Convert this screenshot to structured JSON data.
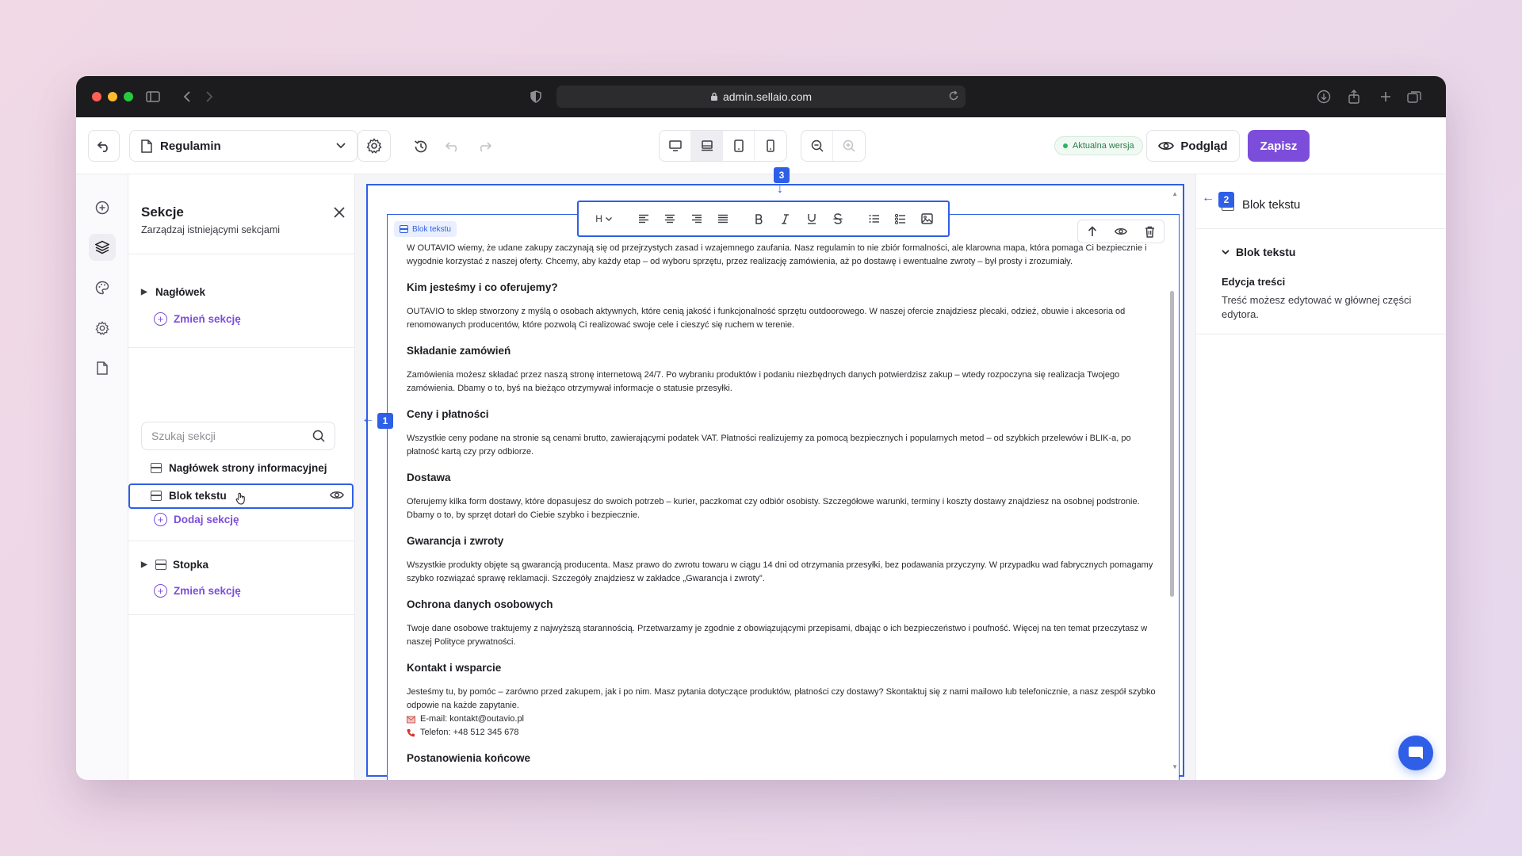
{
  "browser": {
    "url": "admin.sellaio.com"
  },
  "toolbar": {
    "page_name": "Regulamin",
    "version_badge": "Aktualna wersja",
    "preview_label": "Podgląd",
    "save_label": "Zapisz"
  },
  "sections": {
    "title": "Sekcje",
    "subtitle": "Zarządzaj istniejącymi sekcjami",
    "header_group": "Nagłówek",
    "change_header": "Zmień sekcję",
    "search_placeholder": "Szukaj sekcji",
    "items": [
      {
        "label": "Nagłówek strony informacyjnej"
      },
      {
        "label": "Blok tekstu"
      }
    ],
    "add_section": "Dodaj sekcję",
    "footer_group": "Stopka",
    "change_footer": "Zmień sekcję"
  },
  "canvas": {
    "block_tag": "Blok tekstu",
    "heading_button": "H",
    "markers": [
      "1",
      "2",
      "3"
    ],
    "intro": "W OUTAVIO wiemy, że udane zakupy zaczynają się od przejrzystych zasad i wzajemnego zaufania. Nasz regulamin to nie zbiór formalności, ale klarowna mapa, która pomaga Ci bezpiecznie i wygodnie korzystać z naszej oferty. Chcemy, aby każdy etap – od wyboru sprzętu, przez realizację zamówienia, aż po dostawę i ewentualne zwroty – był prosty i zrozumiały.",
    "blocks": [
      {
        "heading": "Kim jesteśmy i co oferujemy?",
        "text": "OUTAVIO to sklep stworzony z myślą o osobach aktywnych, które cenią jakość i funkcjonalność sprzętu outdoorowego. W naszej ofercie znajdziesz plecaki, odzież, obuwie i akcesoria od renomowanych producentów, które pozwolą Ci realizować swoje cele i cieszyć się ruchem w terenie."
      },
      {
        "heading": "Składanie zamówień",
        "text": "Zamówienia możesz składać przez naszą stronę internetową 24/7. Po wybraniu produktów i podaniu niezbędnych danych potwierdzisz zakup – wtedy rozpoczyna się realizacja Twojego zamówienia. Dbamy o to, byś na bieżąco otrzymywał informacje o statusie przesyłki."
      },
      {
        "heading": "Ceny i płatności",
        "text": "Wszystkie ceny podane na stronie są cenami brutto, zawierającymi podatek VAT. Płatności realizujemy za pomocą bezpiecznych i popularnych metod – od szybkich przelewów i BLIK-a, po płatność kartą czy przy odbiorze."
      },
      {
        "heading": "Dostawa",
        "text": "Oferujemy kilka form dostawy, które dopasujesz do swoich potrzeb – kurier, paczkomat czy odbiór osobisty. Szczegółowe warunki, terminy i koszty dostawy znajdziesz na osobnej podstronie. Dbamy o to, by sprzęt dotarł do Ciebie szybko i bezpiecznie."
      },
      {
        "heading": "Gwarancja i zwroty",
        "text": "Wszystkie produkty objęte są gwarancją producenta. Masz prawo do zwrotu towaru w ciągu 14 dni od otrzymania przesyłki, bez podawania przyczyny. W przypadku wad fabrycznych pomagamy szybko rozwiązać sprawę reklamacji. Szczegóły znajdziesz w zakładce „Gwarancja i zwroty”."
      },
      {
        "heading": "Ochrona danych osobowych",
        "text": "Twoje dane osobowe traktujemy z najwyższą starannością. Przetwarzamy je zgodnie z obowiązującymi przepisami, dbając o ich bezpieczeństwo i poufność. Więcej na ten temat przeczytasz w naszej Polityce prywatności."
      },
      {
        "heading": "Kontakt i wsparcie",
        "text": "Jesteśmy tu, by pomóc – zarówno przed zakupem, jak i po nim. Masz pytania dotyczące produktów, płatności czy dostawy? Skontaktuj się z nami mailowo lub telefonicznie, a nasz zespół szybko odpowie na każde zapytanie."
      }
    ],
    "email_line": "E-mail: kontakt@outavio.pl",
    "phone_line": "Telefon: +48 512 345 678",
    "last_heading": "Postanowienia końcowe"
  },
  "inspector": {
    "title": "Blok tekstu",
    "section_title": "Blok tekstu",
    "label": "Edycja treści",
    "description": "Treść możesz edytować w głównej części edytora."
  },
  "colors": {
    "accent": "#7c4ddb",
    "selection": "#2f5fe6",
    "status_green": "#28b463"
  }
}
